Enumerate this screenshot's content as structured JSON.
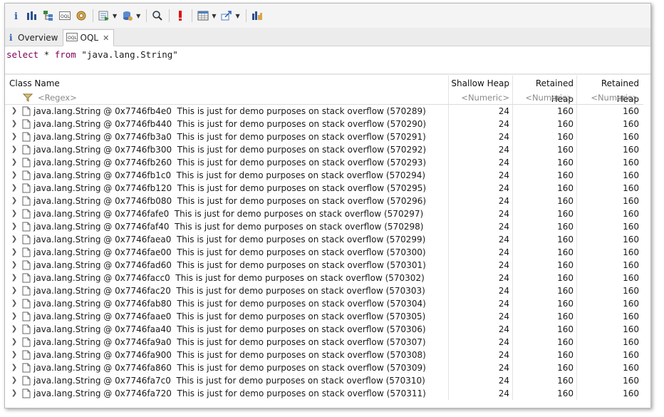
{
  "toolbar": {
    "buttons": [
      {
        "name": "info-icon"
      },
      {
        "name": "histogram-icon"
      },
      {
        "name": "dominator-tree-icon"
      },
      {
        "name": "oql-icon"
      },
      {
        "name": "thread-gear-icon"
      },
      {
        "name": "run-report-icon",
        "dropdown": true
      },
      {
        "name": "query-browser-icon",
        "dropdown": true
      },
      {
        "name": "search-icon"
      },
      {
        "name": "leak-suspect-icon"
      },
      {
        "name": "calculator-icon",
        "dropdown": true
      },
      {
        "name": "export-icon",
        "dropdown": true
      },
      {
        "name": "compare-icon"
      }
    ]
  },
  "tabs": [
    {
      "label": "Overview",
      "active": false
    },
    {
      "label": "OQL",
      "active": true
    }
  ],
  "query": {
    "kw1": "select",
    "star": " * ",
    "kw2": "from",
    "literal": " \"java.lang.String\""
  },
  "table": {
    "columns": [
      "Class Name",
      "Shallow Heap",
      "Retained Heap",
      "Retained Heap"
    ],
    "filters": [
      "<Regex>",
      "<Numeric>",
      "<Numeric>",
      "<Numeric>"
    ],
    "rows": [
      {
        "name": "java.lang.String @ 0x7746fb4e0  This is just for demo purposes on stack overflow (570289)",
        "shallow": "24",
        "retained": "160",
        "retained2": "160"
      },
      {
        "name": "java.lang.String @ 0x7746fb440  This is just for demo purposes on stack overflow (570290)",
        "shallow": "24",
        "retained": "160",
        "retained2": "160"
      },
      {
        "name": "java.lang.String @ 0x7746fb3a0  This is just for demo purposes on stack overflow (570291)",
        "shallow": "24",
        "retained": "160",
        "retained2": "160"
      },
      {
        "name": "java.lang.String @ 0x7746fb300  This is just for demo purposes on stack overflow (570292)",
        "shallow": "24",
        "retained": "160",
        "retained2": "160"
      },
      {
        "name": "java.lang.String @ 0x7746fb260  This is just for demo purposes on stack overflow (570293)",
        "shallow": "24",
        "retained": "160",
        "retained2": "160"
      },
      {
        "name": "java.lang.String @ 0x7746fb1c0  This is just for demo purposes on stack overflow (570294)",
        "shallow": "24",
        "retained": "160",
        "retained2": "160"
      },
      {
        "name": "java.lang.String @ 0x7746fb120  This is just for demo purposes on stack overflow (570295)",
        "shallow": "24",
        "retained": "160",
        "retained2": "160"
      },
      {
        "name": "java.lang.String @ 0x7746fb080  This is just for demo purposes on stack overflow (570296)",
        "shallow": "24",
        "retained": "160",
        "retained2": "160"
      },
      {
        "name": "java.lang.String @ 0x7746fafe0  This is just for demo purposes on stack overflow (570297)",
        "shallow": "24",
        "retained": "160",
        "retained2": "160"
      },
      {
        "name": "java.lang.String @ 0x7746faf40  This is just for demo purposes on stack overflow (570298)",
        "shallow": "24",
        "retained": "160",
        "retained2": "160"
      },
      {
        "name": "java.lang.String @ 0x7746faea0  This is just for demo purposes on stack overflow (570299)",
        "shallow": "24",
        "retained": "160",
        "retained2": "160"
      },
      {
        "name": "java.lang.String @ 0x7746fae00  This is just for demo purposes on stack overflow (570300)",
        "shallow": "24",
        "retained": "160",
        "retained2": "160"
      },
      {
        "name": "java.lang.String @ 0x7746fad60  This is just for demo purposes on stack overflow (570301)",
        "shallow": "24",
        "retained": "160",
        "retained2": "160"
      },
      {
        "name": "java.lang.String @ 0x7746facc0  This is just for demo purposes on stack overflow (570302)",
        "shallow": "24",
        "retained": "160",
        "retained2": "160"
      },
      {
        "name": "java.lang.String @ 0x7746fac20  This is just for demo purposes on stack overflow (570303)",
        "shallow": "24",
        "retained": "160",
        "retained2": "160"
      },
      {
        "name": "java.lang.String @ 0x7746fab80  This is just for demo purposes on stack overflow (570304)",
        "shallow": "24",
        "retained": "160",
        "retained2": "160"
      },
      {
        "name": "java.lang.String @ 0x7746faae0  This is just for demo purposes on stack overflow (570305)",
        "shallow": "24",
        "retained": "160",
        "retained2": "160"
      },
      {
        "name": "java.lang.String @ 0x7746faa40  This is just for demo purposes on stack overflow (570306)",
        "shallow": "24",
        "retained": "160",
        "retained2": "160"
      },
      {
        "name": "java.lang.String @ 0x7746fa9a0  This is just for demo purposes on stack overflow (570307)",
        "shallow": "24",
        "retained": "160",
        "retained2": "160"
      },
      {
        "name": "java.lang.String @ 0x7746fa900  This is just for demo purposes on stack overflow (570308)",
        "shallow": "24",
        "retained": "160",
        "retained2": "160"
      },
      {
        "name": "java.lang.String @ 0x7746fa860  This is just for demo purposes on stack overflow (570309)",
        "shallow": "24",
        "retained": "160",
        "retained2": "160"
      },
      {
        "name": "java.lang.String @ 0x7746fa7c0  This is just for demo purposes on stack overflow (570310)",
        "shallow": "24",
        "retained": "160",
        "retained2": "160"
      },
      {
        "name": "java.lang.String @ 0x7746fa720  This is just for demo purposes on stack overflow (570311)",
        "shallow": "24",
        "retained": "160",
        "retained2": "160"
      }
    ]
  }
}
